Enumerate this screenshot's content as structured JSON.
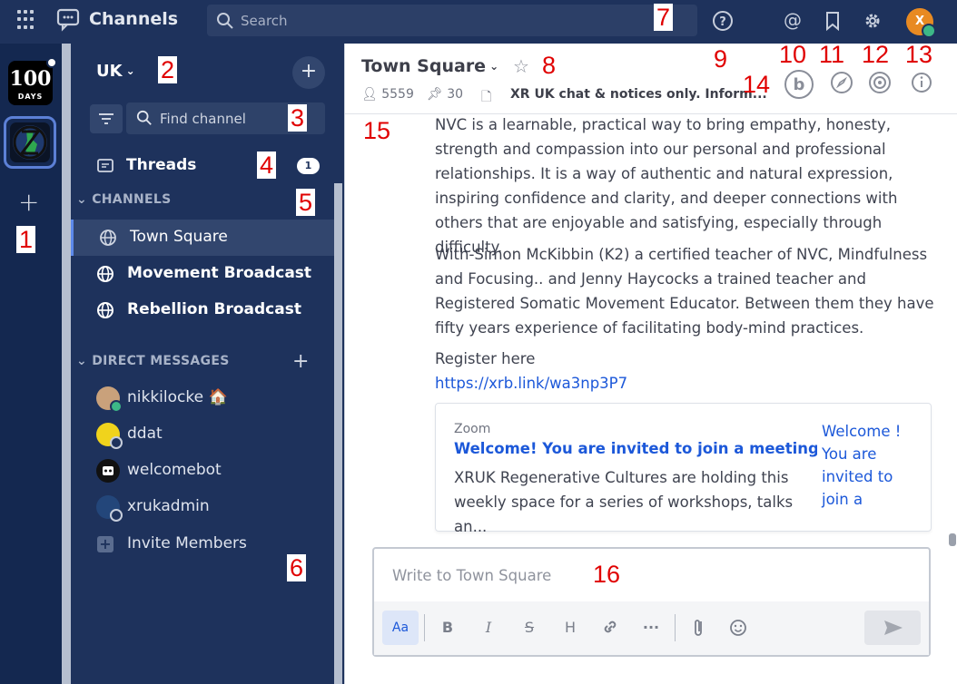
{
  "topbar": {
    "app_title": "Channels",
    "search_placeholder": "Search",
    "user_initial": "X"
  },
  "teams": {
    "team1_number": "100",
    "team1_word": "DAYS"
  },
  "sidebar": {
    "team_name": "UK",
    "find_placeholder": "Find channel",
    "threads_label": "Threads",
    "threads_count": "1",
    "channels_header": "CHANNELS",
    "channels": [
      {
        "label": "Town Square"
      },
      {
        "label": "Movement Broadcast"
      },
      {
        "label": "Rebellion Broadcast"
      }
    ],
    "dm_header": "DIRECT MESSAGES",
    "dms": [
      {
        "label": "nikkilocke 🏠"
      },
      {
        "label": "ddat"
      },
      {
        "label": "welcomebot"
      },
      {
        "label": "xrukadmin"
      }
    ],
    "invite_label": "Invite Members"
  },
  "channel_header": {
    "title": "Town Square",
    "member_count": "5559",
    "pinned_count": "30",
    "purpose": "XR UK chat & notices only. Inform..."
  },
  "post": {
    "para1": "NVC is a learnable, practical way to bring empathy, honesty, strength and compassion into our personal and professional relationships. It is a way of authentic and natural expression, inspiring confidence and clarity, and deeper connections with others that are enjoyable and satisfying, especially through difficulty.",
    "para2": "With-Simon McKibbin (K2)  a certified teacher of NVC, Mindfulness and Focusing.. and Jenny Haycocks  a trained teacher and Registered Somatic Movement Educator. Between them they have fifty years experience of facilitating body-mind practices.",
    "register": "Register here",
    "link": "https://xrb.link/wa3np3P7"
  },
  "embed": {
    "site": "Zoom",
    "title": "Welcome! You are invited to join a meeting: F...",
    "description": "XRUK Regenerative Cultures are holding this weekly space for a series of workshops, talks an...",
    "image_alt": "Welcome ! You are invited to join a"
  },
  "composer": {
    "placeholder": "Write to Town Square",
    "aa": "Aa",
    "bold": "B",
    "italic": "I",
    "strike": "S",
    "heading": "H",
    "more": "···"
  },
  "annotations": [
    "1",
    "2",
    "3",
    "4",
    "5",
    "6",
    "7",
    "8",
    "9",
    "10",
    "11",
    "12",
    "13",
    "14",
    "15",
    "16"
  ],
  "colors": {
    "topbar": "#1e325c",
    "team_sidebar": "#142850",
    "link": "#1c58d9",
    "online": "#3db887",
    "annotation": "#e00000"
  }
}
